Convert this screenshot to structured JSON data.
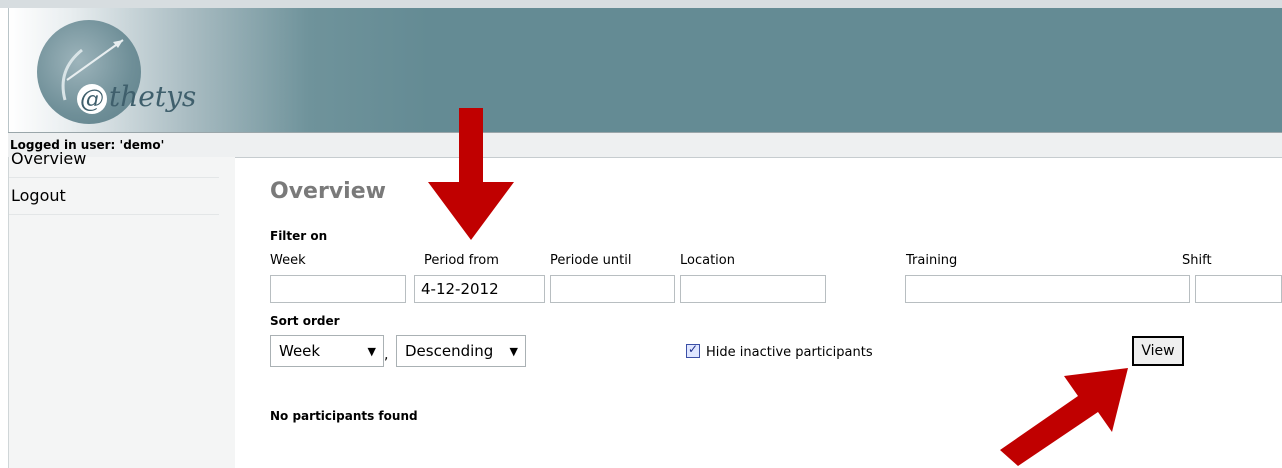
{
  "brand": {
    "logo_text": "thetys",
    "logo_at": "@"
  },
  "user_bar": {
    "text": "Logged in user: 'demo'"
  },
  "sidebar": {
    "items": [
      {
        "label": "Overview"
      },
      {
        "label": "Logout"
      }
    ]
  },
  "main": {
    "title": "Overview",
    "filter": {
      "title": "Filter on",
      "columns": [
        {
          "label": "Week",
          "value": ""
        },
        {
          "label": "Period from",
          "value": "4-12-2012"
        },
        {
          "label": "Periode until",
          "value": ""
        },
        {
          "label": "Location",
          "value": ""
        },
        {
          "label": "Training",
          "value": ""
        },
        {
          "label": "Shift",
          "value": ""
        }
      ]
    },
    "sort": {
      "title": "Sort order",
      "field_selected": "Week",
      "direction_selected": "Descending",
      "separator": ","
    },
    "hide_inactive": {
      "label": "Hide inactive participants",
      "checked": true
    },
    "view_button": {
      "label": "View"
    },
    "result_text": "No participants found"
  },
  "annotations": {
    "arrow_color": "#c00000"
  }
}
